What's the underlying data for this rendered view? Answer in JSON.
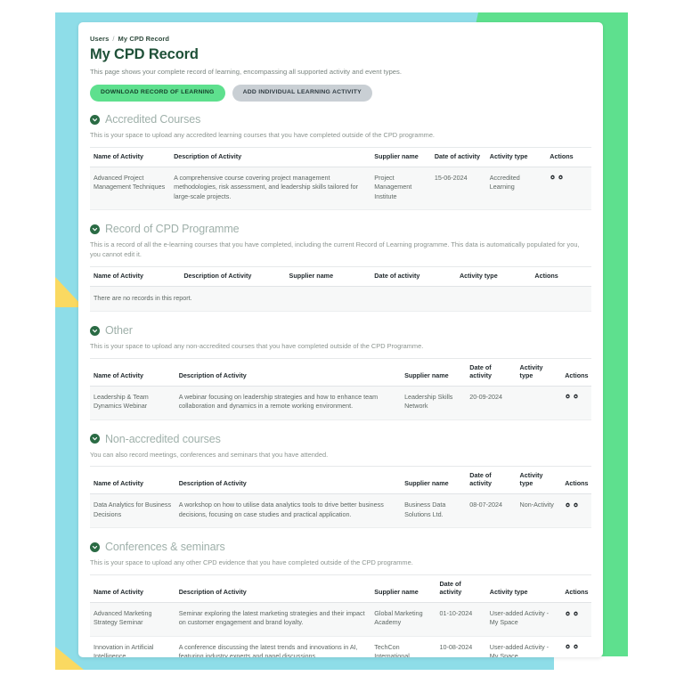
{
  "theme": {
    "band_blue": "#8edde8",
    "band_green": "#5ee08e",
    "accent_yellow": "#fad961",
    "title_green": "#1f5138",
    "primary_button": "#5ee08e",
    "secondary_button": "#c9cfd4",
    "section_icon": "#2a6b44"
  },
  "breadcrumb": {
    "parent": "Users",
    "separator": "/",
    "current": "My CPD Record"
  },
  "header": {
    "title": "My CPD Record",
    "subtitle": "This page shows your complete record of learning, encompassing all supported activity and event types.",
    "buttons": [
      {
        "label": "DOWNLOAD RECORD OF LEARNING",
        "style": "primary"
      },
      {
        "label": "ADD INDIVIDUAL LEARNING ACTIVITY",
        "style": "secondary"
      }
    ]
  },
  "columns_default": [
    "Name of Activity",
    "Description of Activity",
    "Supplier name",
    "Date of activity",
    "Activity type",
    "Actions"
  ],
  "sections": [
    {
      "id": "accredited-courses",
      "title": "Accredited Courses",
      "icon": "chevron-down-circle-icon",
      "description": "This is your space to upload any accredited learning courses that you have completed outside of the CPD programme.",
      "columns": [
        "Name of Activity",
        "Description of Activity",
        "Supplier name",
        "Date of activity",
        "Activity type",
        "Actions"
      ],
      "widths": [
        "16%",
        "40%",
        "12%",
        "11%",
        "12%",
        "9%"
      ],
      "empty_message": "",
      "rows": [
        {
          "name": "Advanced Project Management Techniques",
          "description": "A comprehensive course covering project management methodologies, risk assessment, and leadership skills tailored for large-scale projects.",
          "supplier": "Project Management Institute",
          "date": "15-06-2024",
          "type": "Accredited Learning",
          "actions": [
            "gear-icon",
            "gear-icon"
          ]
        }
      ]
    },
    {
      "id": "record-of-cpd-programme",
      "title": "Record of CPD Programme",
      "icon": "chevron-down-circle-icon",
      "description": "This is a record of all the e-learning courses that you have completed, including the current Record of Learning programme. This data is automatically populated for you, you cannot edit it.",
      "columns": [
        "Name of Activity",
        "Description of Activity",
        "Supplier name",
        "Date of activity",
        "Activity type",
        "Actions"
      ],
      "widths": [
        "18%",
        "21%",
        "17%",
        "17%",
        "15%",
        "12%"
      ],
      "empty_message": "There are no records in this report.",
      "rows": []
    },
    {
      "id": "other",
      "title": "Other",
      "icon": "chevron-down-circle-icon",
      "description": "This is your space to upload any non-accredited courses that you have completed outside of the CPD Programme.",
      "columns": [
        "Name of Activity",
        "Description of Activity",
        "Supplier name",
        "Date of activity",
        "Activity type",
        "Actions"
      ],
      "widths": [
        "17%",
        "45%",
        "13%",
        "10%",
        "9%",
        "6%"
      ],
      "empty_message": "",
      "rows": [
        {
          "name": "Leadership & Team Dynamics Webinar",
          "description": "A webinar focusing on leadership strategies and how to enhance team collaboration and dynamics in a remote working environment.",
          "supplier": "Leadership Skills Network",
          "date": "20-09-2024",
          "type": "",
          "actions": [
            "gear-icon",
            "gear-icon"
          ]
        }
      ]
    },
    {
      "id": "non-accredited-courses",
      "title": "Non-accredited courses",
      "icon": "chevron-down-circle-icon",
      "description": "You can also record meetings, conferences and seminars that you have attended.",
      "columns": [
        "Name of Activity",
        "Description of Activity",
        "Supplier name",
        "Date of activity",
        "Activity type",
        "Actions"
      ],
      "widths": [
        "17%",
        "45%",
        "13%",
        "10%",
        "9%",
        "6%"
      ],
      "empty_message": "",
      "rows": [
        {
          "name": "Data Analytics for Business Decisions",
          "description": "A workshop on how to utilise data analytics tools to drive better business decisions, focusing on case studies and practical application.",
          "supplier": "Business Data Solutions Ltd.",
          "date": "08-07-2024",
          "type": "Non-Activity",
          "actions": [
            "gear-icon",
            "gear-icon"
          ]
        }
      ]
    },
    {
      "id": "conferences-seminars",
      "title": "Conferences & seminars",
      "icon": "chevron-down-circle-icon",
      "description": "This is your space to upload any other CPD evidence that you have completed outside of the CPD programme.",
      "columns": [
        "Name of Activity",
        "Description of Activity",
        "Supplier name",
        "Date of activity",
        "Activity type",
        "Actions"
      ],
      "widths": [
        "17%",
        "39%",
        "13%",
        "10%",
        "15%",
        "6%"
      ],
      "empty_message": "",
      "rows": [
        {
          "name": "Advanced Marketing Strategy Seminar",
          "description": "Seminar exploring the latest marketing strategies and their impact on customer engagement and brand loyalty.",
          "supplier": "Global Marketing Academy",
          "date": "01-10-2024",
          "type": "User-added Activity - My Space",
          "actions": [
            "gear-icon",
            "gear-icon"
          ]
        },
        {
          "name": "Innovation in Artificial Intelligence",
          "description": "A conference discussing the latest trends and innovations in AI, featuring industry experts and panel discussions.",
          "supplier": "TechCon International",
          "date": "10-08-2024",
          "type": "User-added Activity - My Space",
          "actions": [
            "gear-icon",
            "gear-icon"
          ]
        }
      ]
    }
  ]
}
